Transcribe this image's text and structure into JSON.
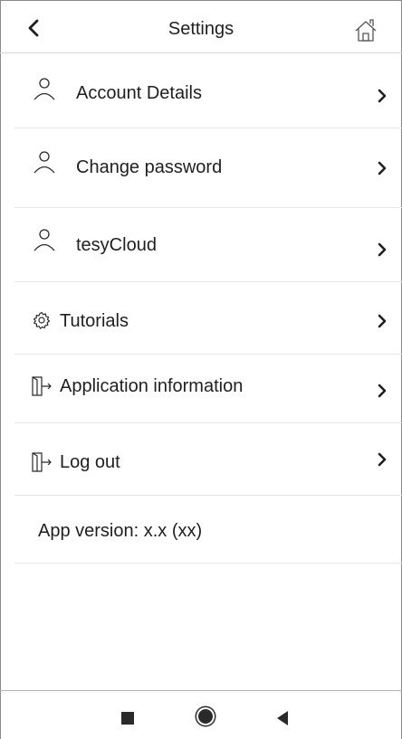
{
  "header": {
    "title": "Settings",
    "back_icon": "chevron-left-icon",
    "home_icon": "home-icon"
  },
  "menu": {
    "items": [
      {
        "label": "Account Details",
        "icon": "user-icon"
      },
      {
        "label": "Change password",
        "icon": "user-icon"
      },
      {
        "label": "tesyCloud",
        "icon": "user-icon"
      },
      {
        "label": "Tutorials",
        "icon": "gear-icon"
      },
      {
        "label": "Application information",
        "icon": "door-exit-icon"
      },
      {
        "label": "Log out",
        "icon": "door-exit-icon"
      }
    ]
  },
  "version": {
    "label": "App version: x.x (xx)"
  },
  "navbar": {
    "buttons": [
      "square-recents-icon",
      "circle-home-icon",
      "triangle-back-icon"
    ]
  },
  "colors": {
    "text": "#1f1f1f",
    "divider": "#e6e6e6"
  }
}
